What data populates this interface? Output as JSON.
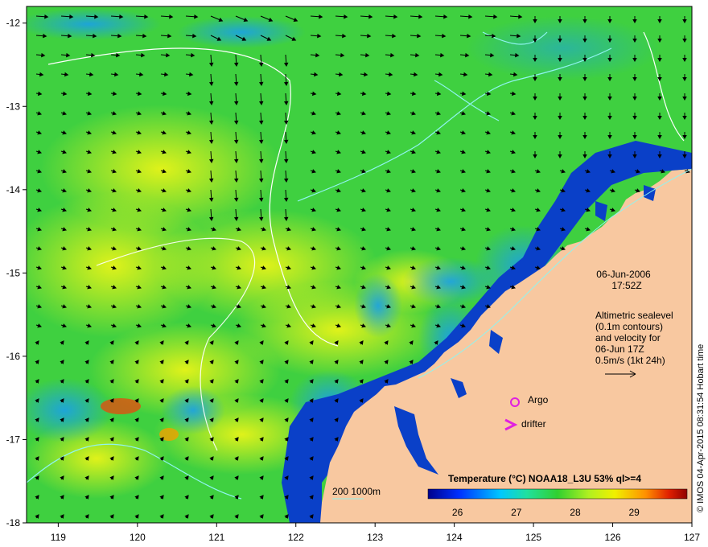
{
  "map": {
    "datetime_line1": "06-Jun-2006",
    "datetime_line2": "17:52Z",
    "velocity_note": [
      "Altimetric sealevel",
      "(0.1m contours)",
      "and velocity for",
      "06-Jun 17Z",
      "0.5m/s (1kt 24h)"
    ],
    "legend_title": "Temperature (°C) NOAA18_L3U 53% ql>=4",
    "legend_ticks": [
      "26",
      "27",
      "28",
      "29"
    ],
    "legend_range": [
      25.5,
      29.9
    ],
    "depth_label": "200  1000m",
    "argo_label": "Argo",
    "drifter_label": "drifter",
    "credit": "© IMOS 04-Apr-2015 08:31:54 Hobart time",
    "x_ticks": [
      "119",
      "120",
      "121",
      "122",
      "123",
      "124",
      "125",
      "126",
      "127"
    ],
    "y_ticks": [
      "-12",
      "-13",
      "-14",
      "-15",
      "-16",
      "-17",
      "-18"
    ],
    "lon_range": [
      118.6,
      127.0
    ],
    "lat_range": [
      -18.0,
      -11.8
    ],
    "colors": {
      "land": "#f8c8a0",
      "ocean_mid": "#3fd040",
      "ocean_warm": "#d8f020",
      "ocean_cool": "#0a40c8",
      "contour": "#8ff4f0",
      "marker": "#e020e0"
    }
  }
}
